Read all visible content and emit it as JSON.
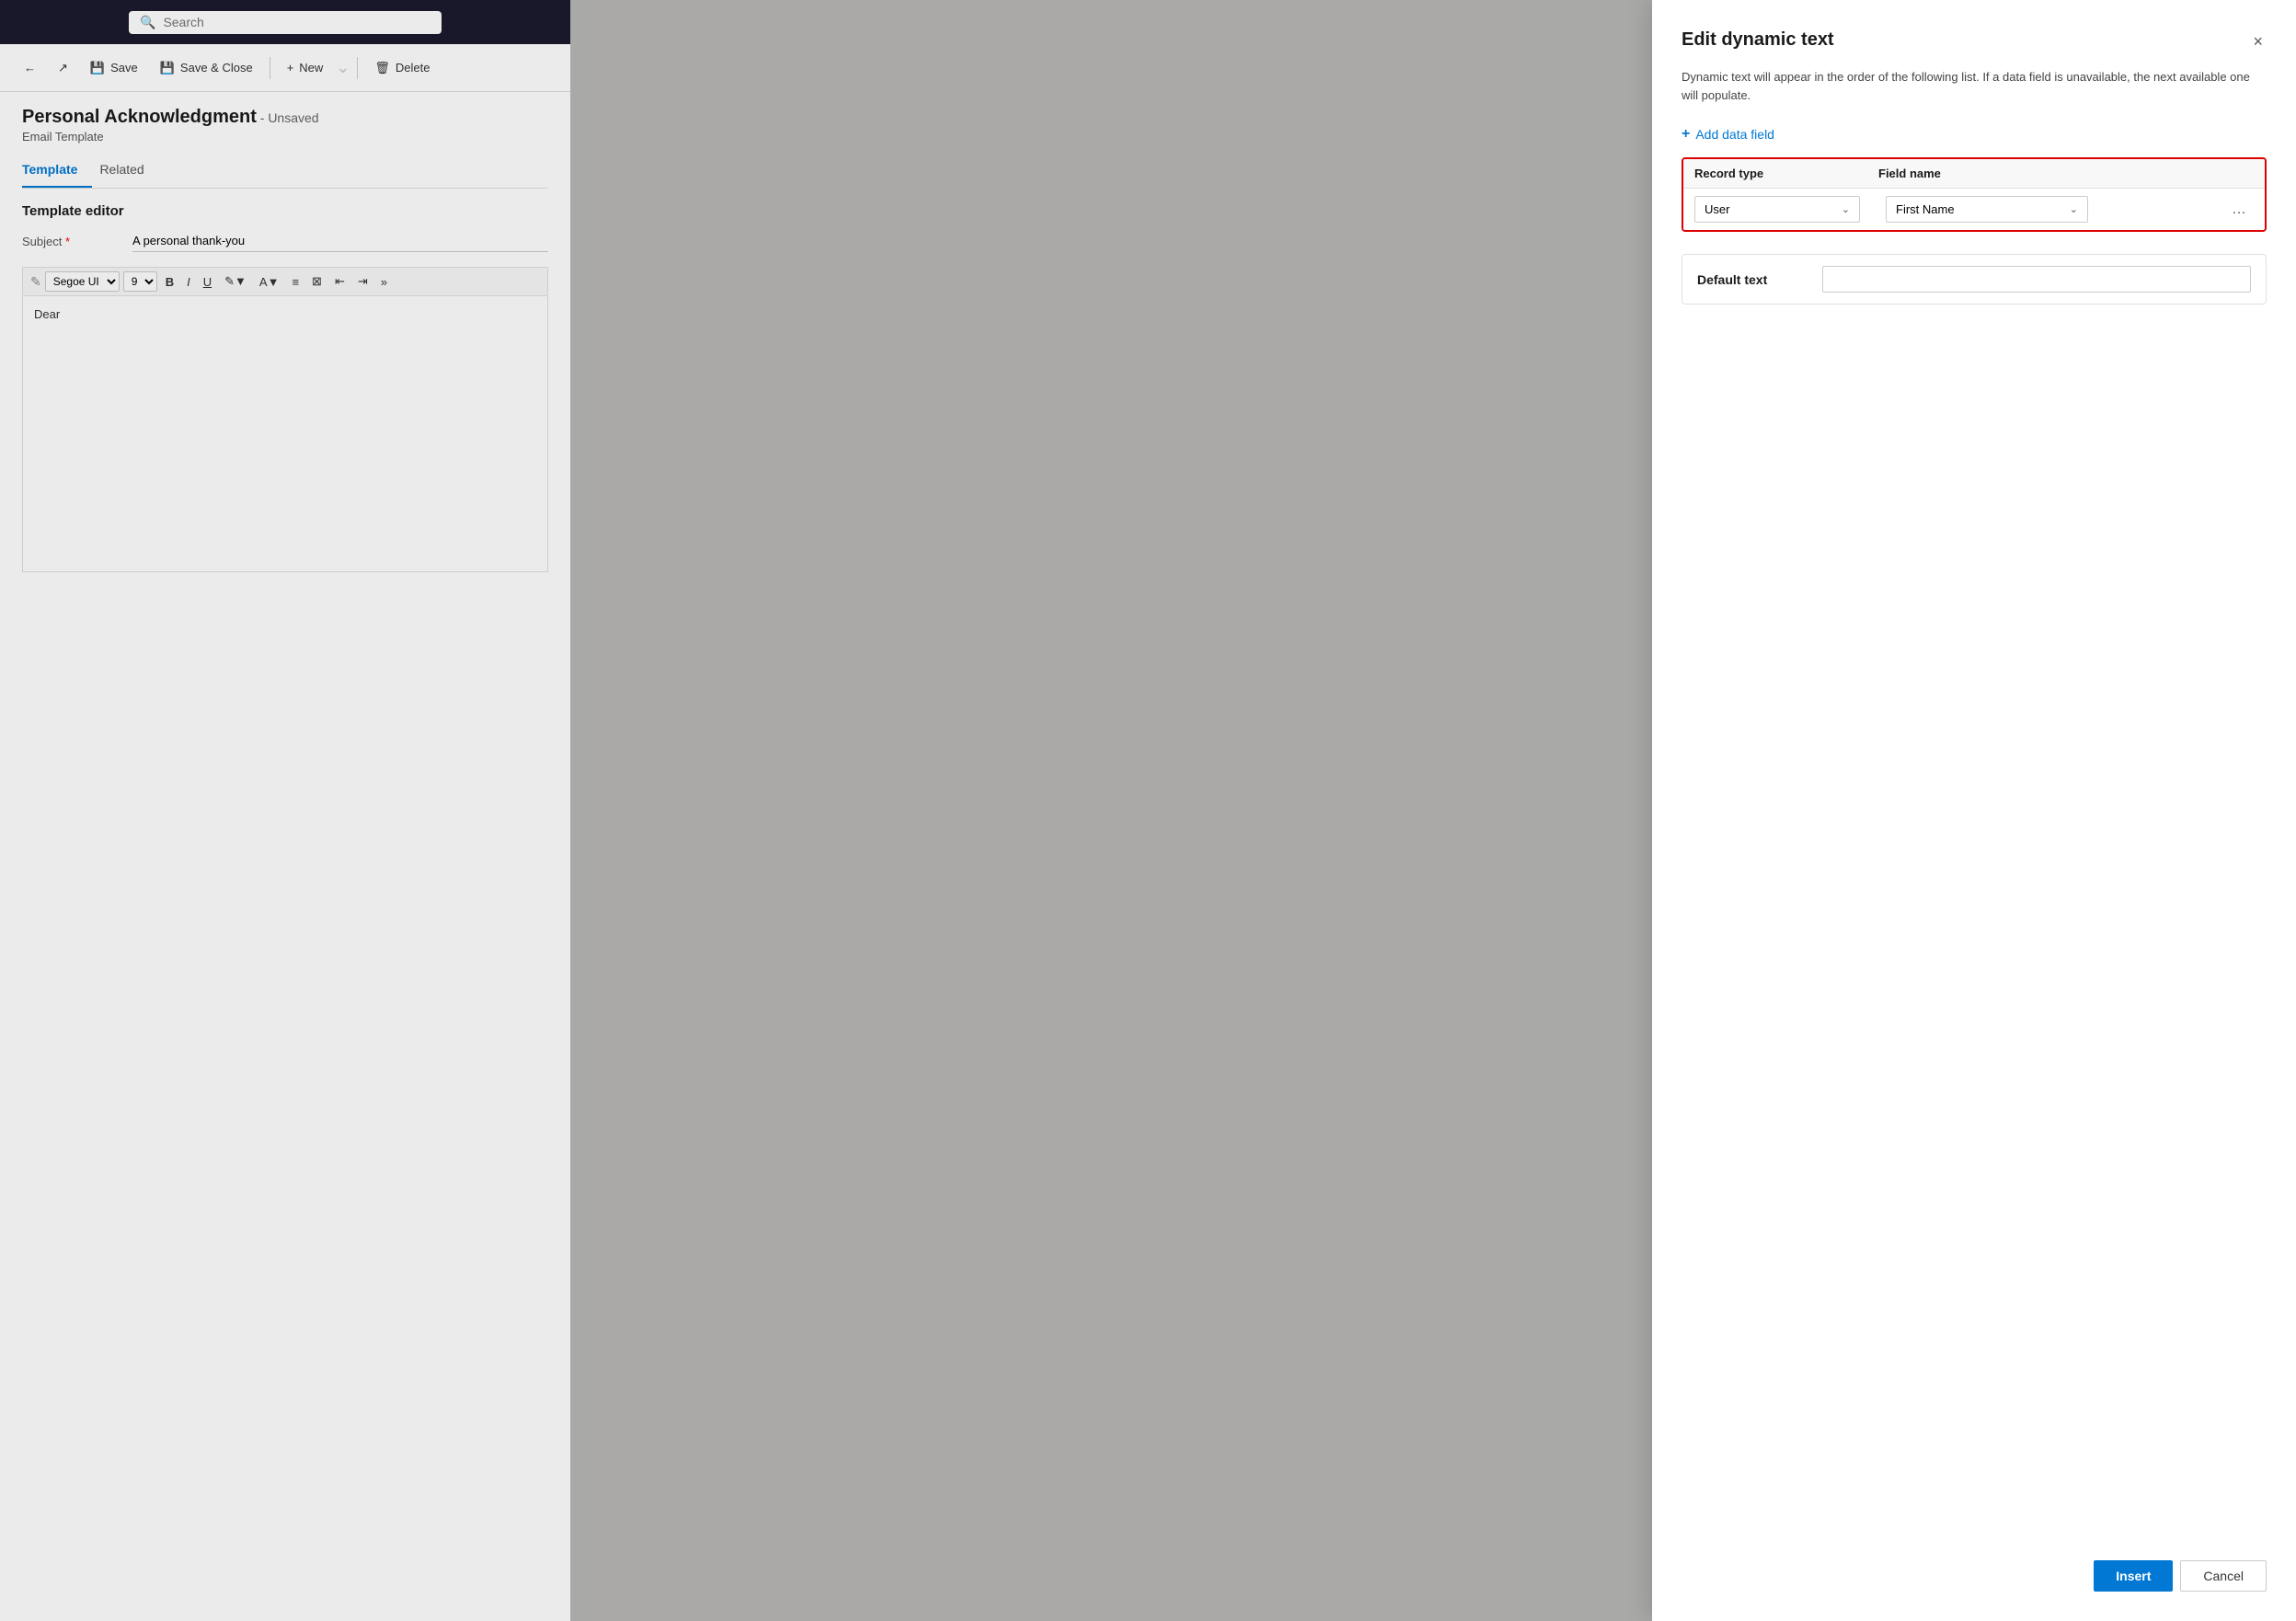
{
  "topbar": {
    "search_placeholder": "Search"
  },
  "toolbar": {
    "back_label": "",
    "share_label": "",
    "save_label": "Save",
    "save_close_label": "Save & Close",
    "new_label": "New",
    "delete_label": "Delete"
  },
  "record": {
    "title": "Personal Acknowledgment",
    "unsaved": "- Unsaved",
    "subtitle": "Email Template"
  },
  "tabs": [
    {
      "label": "Template",
      "active": true
    },
    {
      "label": "Related",
      "active": false
    }
  ],
  "editor": {
    "section_title": "Template editor",
    "subject_label": "Subject",
    "subject_value": "A personal thank-you",
    "font_family": "Segoe UI",
    "font_size": "9",
    "body_text": "Dear"
  },
  "modal": {
    "title": "Edit dynamic text",
    "description": "Dynamic text will appear in the order of the following list. If a data field is unavailable, the next available one will populate.",
    "add_field_label": "Add data field",
    "close_label": "×",
    "table_header_record": "Record type",
    "table_header_field": "Field name",
    "row_record_value": "User",
    "row_field_value": "First Name",
    "default_text_label": "Default text",
    "default_text_placeholder": "",
    "insert_label": "Insert",
    "cancel_label": "Cancel"
  }
}
